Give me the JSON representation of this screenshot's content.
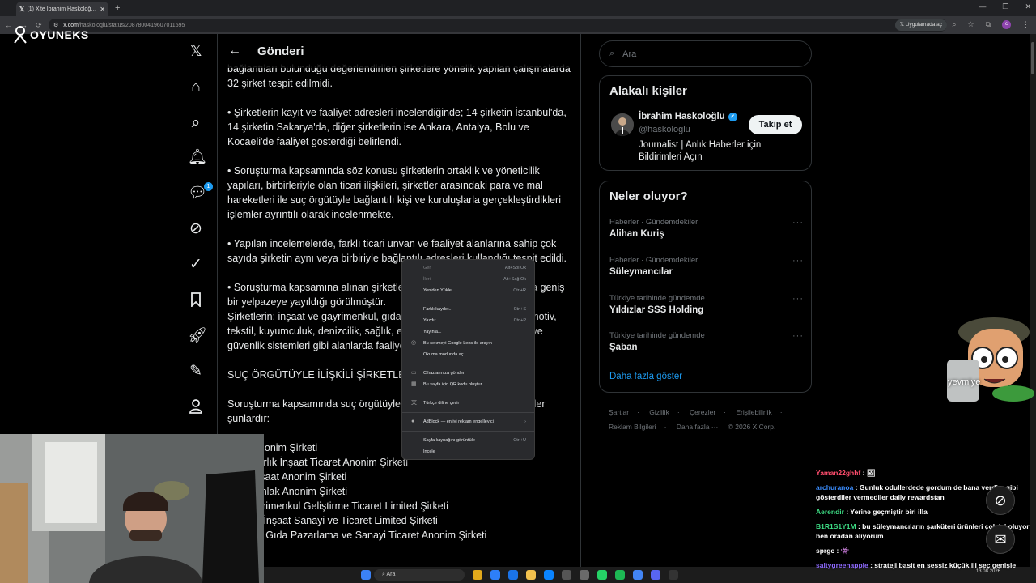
{
  "browser": {
    "tab_title": "(1) X'te İbrahim Haskoloğlu: \"S...",
    "url_host": "x.com",
    "url_path": "/haskologlu/status/2087800419607011595",
    "open_in_app": "Uygulamada aç",
    "profile_initial": "c"
  },
  "overlay_logo": "OYUNEKS",
  "x_sidebar": {
    "notifications_badge": "1"
  },
  "post": {
    "header_title": "Gönderi",
    "paragraphs": [
      "bağlantıları bulunduğu değerlendirilen şirketlere yönelik yapılan çalışmalarda 32 şirket tespit edilmidi.",
      "• Şirketlerin kayıt ve faaliyet adresleri incelendiğinde; 14 şirketin İstanbul'da, 14 şirketin Sakarya'da, diğer şirketlerin ise Ankara, Antalya, Bolu ve Kocaeli'de faaliyet gösterdiği belirlendi.",
      "• Soruşturma kapsamında söz konusu şirketlerin ortaklık ve yöneticilik yapıları, birbirleriyle olan ticari ilişkileri, şirketler arasındaki para ve mal hareketleri ile suç örgütüyle bağlantılı kişi ve kuruluşlarla gerçekleştirdikleri işlemler ayrıntılı olarak incelenmekte.",
      "• Yapılan incelemelerde, farklı ticari unvan ve faaliyet alanlarına sahip çok sayıda şirketin aynı veya birbiriyle bağlantılı adresleri kullandığı tespit edildi.",
      "• Soruşturma kapsamına alınan şirketlerin faaliyet alanlarının oldukça geniş bir yelpazeye yayıldığı görülmüştür.\nŞirketlerin; inşaat ve gayrimenkul, gıda, otomotiv, lojistik, turizm, otomotiv, tekstil, kuyumculuk, denizcilik, sağlık, enerji, hayat, tarım, elektronik ve güvenlik sistemleri gibi alanlarda faaliyet gösterdiği tespit edildi.",
      "SUÇ ÖRGÜTÜYLE İLİŞKİLİ ŞİRKETLER",
      "Soruşturma kapsamında suç örgütüyle ilişkili olduğu belirlenen şirketler şunlardır:"
    ],
    "companies": [
      "...apı Anonim Şirketi",
      "... Mimarlık İnşaat Ticaret Anonim Şirketi",
      "...niz İnşaat Anonim Şirketi",
      "...niz Emlak Anonim Şirketi",
      "...ti Gayrimenkul Geliştirme Ticaret Limited Şirketi",
      "... Gıda İnşaat Sanayi ve Ticaret Limited Şirketi",
      "...yonuz Gıda Pazarlama ve Sanayi Ticaret Anonim Şirketi"
    ]
  },
  "right": {
    "search_placeholder": "Ara",
    "related_title": "Alakalı kişiler",
    "person": {
      "name": "İbrahim Haskoloğlu",
      "handle": "@haskologlu",
      "bio": "Journalist | Anlık Haberler için Bildirimleri Açın",
      "follow_label": "Takip et"
    },
    "trends_title": "Neler oluyor?",
    "trends": [
      {
        "context": "Haberler · Gündemdekiler",
        "name": "Alihan Kuriş"
      },
      {
        "context": "Haberler · Gündemdekiler",
        "name": "Süleymancılar"
      },
      {
        "context": "Türkiye tarihinde gündemde",
        "name": "Yıldızlar SSS Holding"
      },
      {
        "context": "Türkiye tarihinde gündemde",
        "name": "Şaban"
      }
    ],
    "show_more": "Daha fazla göster",
    "footer": [
      "Şartlar",
      "Gizlilik",
      "Çerezler",
      "Erişilebilirlik",
      "Reklam Bilgileri",
      "Daha fazla ···",
      "© 2026 X Corp."
    ]
  },
  "context_menu": [
    {
      "label": "Geri",
      "shortcut": "Alt+Sol Ok",
      "disabled": true
    },
    {
      "label": "İleri",
      "shortcut": "Alt+Sağ Ok",
      "disabled": true
    },
    {
      "label": "Yeniden Yükle",
      "shortcut": "Ctrl+R"
    },
    {
      "sep": true
    },
    {
      "label": "Farklı kaydet...",
      "shortcut": "Ctrl+S"
    },
    {
      "label": "Yazdır...",
      "shortcut": "Ctrl+P"
    },
    {
      "label": "Yayınla...",
      "shortcut": ""
    },
    {
      "label": "Bu sekmeyi Google Lens ile arayın",
      "shortcut": "",
      "icon": "◎"
    },
    {
      "label": "Okuma modunda aç",
      "shortcut": ""
    },
    {
      "sep": true
    },
    {
      "label": "Cihazlarınıza gönder",
      "shortcut": "",
      "icon": "▭"
    },
    {
      "label": "Bu sayfa için QR kodu oluştur",
      "shortcut": "",
      "icon": "▦"
    },
    {
      "sep": true
    },
    {
      "label": "Türkçe diline çevir",
      "shortcut": "",
      "icon": "文"
    },
    {
      "sep": true
    },
    {
      "label": "AdBlock — en iyi reklam engelleyici",
      "shortcut": "›",
      "icon": "●"
    },
    {
      "sep": true
    },
    {
      "label": "Sayfa kaynağını görüntüle",
      "shortcut": "Ctrl+U"
    },
    {
      "label": "İncele",
      "shortcut": ""
    }
  ],
  "mascot_label": "yevmiye",
  "chat": [
    {
      "user": "Yaman22ghhf",
      "color": "#ff4d6d",
      "msg": "🖼"
    },
    {
      "user": "archuranoa",
      "color": "#3a8dff",
      "msg": "Gunluk odullerdede gordum de bana verdim gibi gösterdiler vermediler daily rewardstan"
    },
    {
      "user": "Aerendir",
      "color": "#3ddc84",
      "msg": "Yerine geçmiştir biri illa"
    },
    {
      "user": "B1R1S1Y1M",
      "color": "#3ddc84",
      "msg": "bu süleymancıların şarküteri ürünleri çok iyi oluyor ben oradan alıyorum"
    },
    {
      "user": "sprgc",
      "color": "#ffffff",
      "msg": "👾"
    },
    {
      "user": "saltygreenapple",
      "color": "#8f6bff",
      "msg": "strateji basit en sessiz küçük ili seç genişle"
    }
  ],
  "taskbar": {
    "search_placeholder": "Ara",
    "time": "13.08.2026"
  }
}
